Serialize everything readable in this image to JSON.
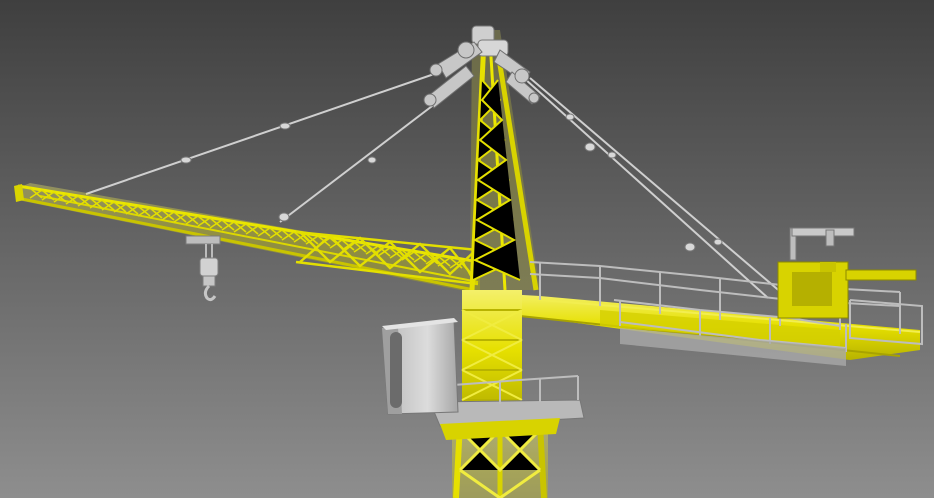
{
  "scene": {
    "subject": "tower-crane",
    "colors": {
      "background_top": "#3f3f3f",
      "background_bottom": "#8e8e8e",
      "steel_yellow": "#e6e000",
      "steel_yellow_dark": "#b8b300",
      "steel_yellow_light": "#f4f06a",
      "grey_metal": "#c9c9c9",
      "grey_metal_dark": "#8c8c8c",
      "cable": "#cfcfcf",
      "cab_window": "#6b6b6b"
    }
  }
}
